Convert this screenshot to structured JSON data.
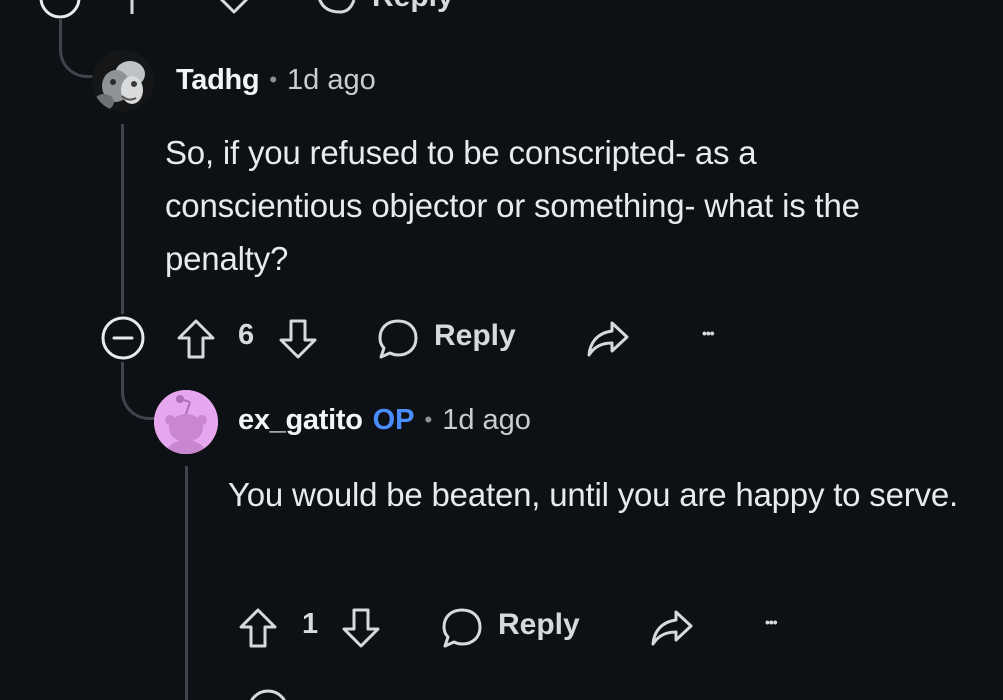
{
  "top_actions": {
    "reply_label": "Reply"
  },
  "comments": [
    {
      "author": "Tadhg",
      "separator": "•",
      "time": "1d ago",
      "body": "So, if you refused to be conscripted- as a conscientious objector or something- what is the  penalty?",
      "votes": "6",
      "reply_label": "Reply",
      "more_label": "•••"
    },
    {
      "author": "ex_gatito",
      "badge": "OP",
      "separator": "•",
      "time": "1d ago",
      "body": "You would be beaten, until you are happy to serve.",
      "votes": "1",
      "reply_label": "Reply",
      "more_label": "•••"
    }
  ],
  "colors": {
    "background": "#0d1014",
    "thread_line": "#3e4449",
    "op_badge": "#4a8dff",
    "snoo_avatar_bg": "#e7a7ee"
  }
}
